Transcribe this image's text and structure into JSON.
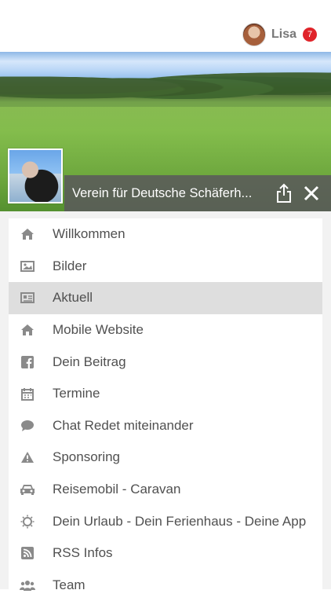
{
  "header": {
    "username": "Lisa",
    "notification_count": "7"
  },
  "hero": {
    "title": "Verein für Deutsche Schäferh..."
  },
  "menu": {
    "items": [
      {
        "label": "Willkommen",
        "icon": "home-icon",
        "active": false
      },
      {
        "label": "Bilder",
        "icon": "image-icon",
        "active": false
      },
      {
        "label": "Aktuell",
        "icon": "newspaper-icon",
        "active": true
      },
      {
        "label": "Mobile Website",
        "icon": "home-icon",
        "active": false
      },
      {
        "label": "Dein Beitrag",
        "icon": "facebook-icon",
        "active": false
      },
      {
        "label": "Termine",
        "icon": "calendar-icon",
        "active": false
      },
      {
        "label": "Chat Redet miteinander",
        "icon": "chat-bubble-icon",
        "active": false
      },
      {
        "label": "Sponsoring",
        "icon": "warning-icon",
        "active": false
      },
      {
        "label": "Reisemobil - Caravan",
        "icon": "car-icon",
        "active": false
      },
      {
        "label": "Dein Urlaub - Dein Ferienhaus - Deine App",
        "icon": "sun-icon",
        "active": false
      },
      {
        "label": "RSS Infos",
        "icon": "rss-icon",
        "active": false
      },
      {
        "label": "Team",
        "icon": "team-icon",
        "active": false
      }
    ]
  },
  "colors": {
    "badge": "#e0242a",
    "menu_text": "#505050",
    "icon_gray": "#8a8a8a",
    "active_row": "#dedede",
    "titlebar": "#5a5a5a"
  }
}
